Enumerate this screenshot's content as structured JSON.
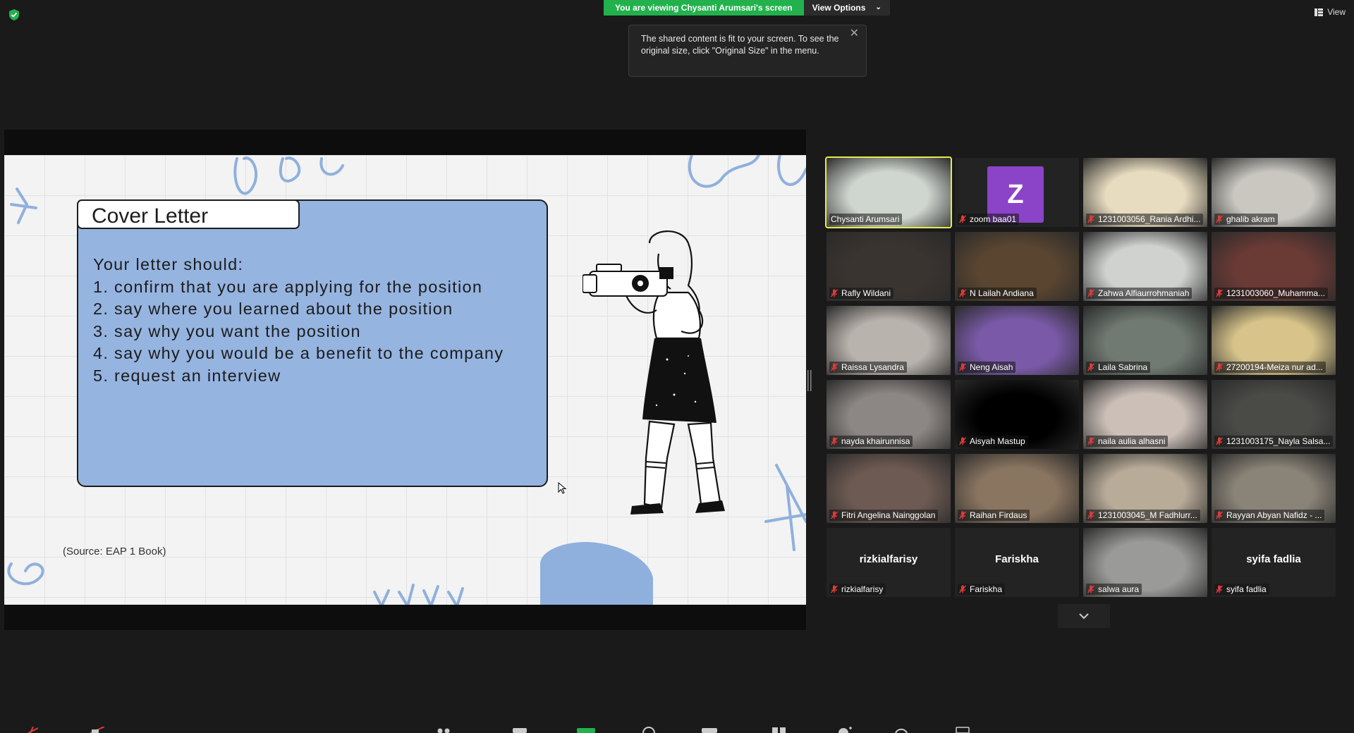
{
  "banner": {
    "viewing_label": "You are viewing Chysanti Arumsari's screen",
    "view_options_label": "View Options"
  },
  "tooltip": {
    "text": "The shared content is fit to your screen. To see the original size, click \"Original Size\" in the menu."
  },
  "view_button": {
    "label": "View"
  },
  "slide": {
    "title": "Cover Letter",
    "lines": [
      "Your letter should:",
      "1. confirm that you are applying for the position",
      "2. say where you learned about the position",
      "3. say why you want the position",
      "4. say why you would be a benefit to the company",
      "5. request an interview"
    ],
    "source": "(Source: EAP 1 Book)"
  },
  "colors": {
    "speaking_outline": "#e6ec4a",
    "banner_green": "#23b14d",
    "slide_card_blue": "#95b4e0",
    "avatar_purple": "#8b44c8",
    "mute_red": "#e03a3a"
  },
  "participants": [
    {
      "name": "Chysanti Arumsari",
      "speaking": true,
      "muted": false,
      "video": "#cfd5cf"
    },
    {
      "name": "zoom baa01",
      "muted": true,
      "avatar_letter": "Z"
    },
    {
      "name": "1231003056_Rania Ardhi...",
      "muted": true,
      "video": "#e8dcc0"
    },
    {
      "name": "ghalib akram",
      "muted": true,
      "video": "#c9c7c0"
    },
    {
      "name": "Rafly Wildani",
      "muted": true,
      "video": "#3a3430"
    },
    {
      "name": "N Lailah Andiana",
      "muted": true,
      "video": "#5a4530"
    },
    {
      "name": "Zahwa Alfiaurrohmaniah",
      "muted": true,
      "video": "#cfd2cf"
    },
    {
      "name": "1231003060_Muhamma...",
      "muted": true,
      "video": "#6a3a35"
    },
    {
      "name": "Raissa Lysandra",
      "muted": true,
      "video": "#b9b3ad"
    },
    {
      "name": "Neng Aisah",
      "muted": true,
      "video": "#7a5aa8"
    },
    {
      "name": "Laila Sabrina",
      "muted": true,
      "video": "#707a72"
    },
    {
      "name": "27200194-Meiza nur ad...",
      "muted": true,
      "video": "#d8c48a"
    },
    {
      "name": "nayda khairunnisa",
      "muted": true,
      "video": "#8c8784"
    },
    {
      "name": "Aisyah Mastup",
      "muted": true,
      "video": "#000000"
    },
    {
      "name": "naila aulia alhasni",
      "muted": true,
      "video": "#cbbfb8"
    },
    {
      "name": "1231003175_Nayla Salsa...",
      "muted": true,
      "video": "#4a4a47"
    },
    {
      "name": "Fitri Angelina Nainggolan",
      "muted": true,
      "video": "#6d5a52"
    },
    {
      "name": "Raihan Firdaus",
      "muted": true,
      "video": "#8a7560"
    },
    {
      "name": "1231003045_M Fadhlurr...",
      "muted": true,
      "video": "#b8ab98"
    },
    {
      "name": "Rayyan Abyan Nafidz - ...",
      "muted": true,
      "video": "#8a8478"
    },
    {
      "name": "rizkialfarisy",
      "muted": true,
      "big": "rizkialfarisy"
    },
    {
      "name": "Fariskha",
      "muted": true,
      "big": "Fariskha"
    },
    {
      "name": "salwa aura",
      "muted": true,
      "video": "#9a9a98"
    },
    {
      "name": "syifa fadlia",
      "muted": true,
      "big": "syifa fadlia"
    }
  ]
}
